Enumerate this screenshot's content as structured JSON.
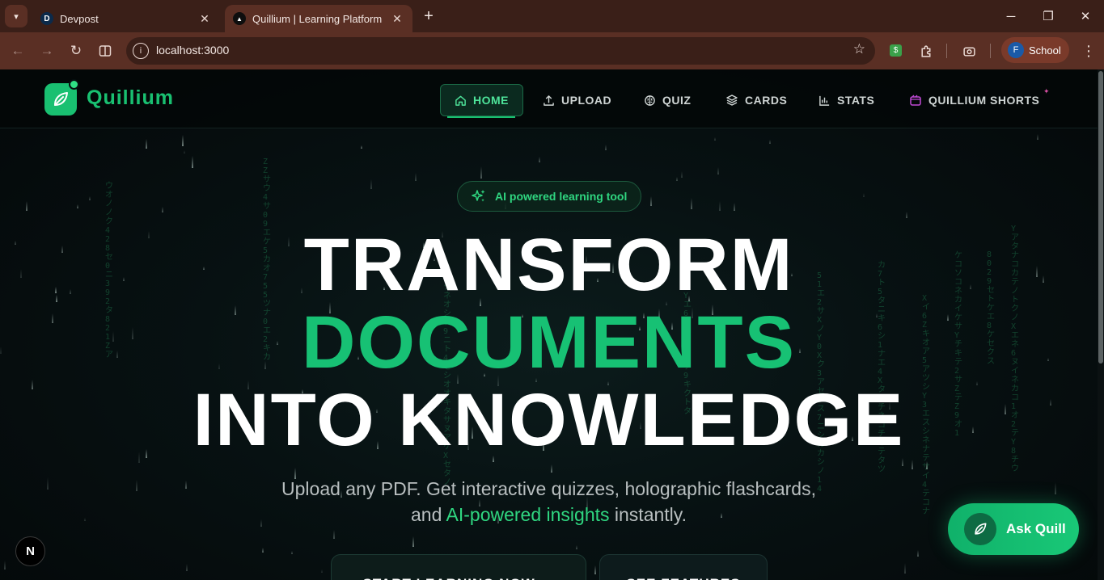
{
  "browser": {
    "tabs": [
      {
        "favicon": "D",
        "title": "Devpost",
        "active": false
      },
      {
        "favicon": "▲",
        "title": "Quillium | Learning Platform",
        "active": true
      }
    ],
    "url": "localhost:3000",
    "extension_badge": "$",
    "profile": {
      "initial": "F",
      "name": "School"
    }
  },
  "site": {
    "brand": "Quillium",
    "nav": [
      {
        "label": "HOME",
        "icon": "home-icon",
        "active": true
      },
      {
        "label": "UPLOAD",
        "icon": "upload-icon"
      },
      {
        "label": "QUIZ",
        "icon": "brain-icon"
      },
      {
        "label": "CARDS",
        "icon": "layers-icon"
      },
      {
        "label": "STATS",
        "icon": "bar-chart-icon"
      },
      {
        "label": "QUILLIUM SHORTS",
        "icon": "video-icon"
      }
    ],
    "colors": {
      "accent": "#19c071",
      "background": "#060b0c",
      "shorts_icon": "#c14ad6"
    }
  },
  "hero": {
    "badge": "AI powered learning tool",
    "title_line1": "TRANSFORM",
    "title_line2": "DOCUMENTS",
    "title_line3": "INTO KNOWLEDGE",
    "subtitle_line1": "Upload any PDF. Get interactive quizzes, holographic flashcards,",
    "subtitle_line2_pre": "and",
    "subtitle_line2_highlight": "AI-powered insights",
    "subtitle_line2_post": "instantly.",
    "cta_primary": "START LEARNING NOW →",
    "cta_secondary": "SEE FEATURES"
  },
  "assistant": {
    "label": "Ask Quill"
  },
  "dev_indicator": "N"
}
